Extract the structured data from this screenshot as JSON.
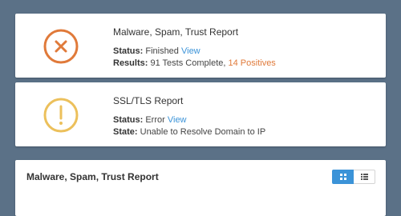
{
  "colors": {
    "background": "#5b7187",
    "error_icon": "#e07a3a",
    "warning_icon": "#ecc05b",
    "link": "#3b93d8",
    "positives": "#e07a3a"
  },
  "cards": [
    {
      "icon": "x-circle-icon",
      "title": "Malware, Spam, Trust Report",
      "line1_label": "Status:",
      "line1_value": "Finished",
      "line1_link": "View",
      "line2_label": "Results:",
      "line2_value": "91 Tests Complete,",
      "line2_highlight": "14 Positives"
    },
    {
      "icon": "exclamation-circle-icon",
      "title": "SSL/TLS Report",
      "line1_label": "Status:",
      "line1_value": "Error",
      "line1_link": "View",
      "line2_label": "State:",
      "line2_value": "Unable to Resolve Domain to IP"
    }
  ],
  "panel": {
    "title": "Malware, Spam, Trust Report",
    "view_toggle": [
      {
        "icon": "grid-view-icon",
        "active": true
      },
      {
        "icon": "list-view-icon",
        "active": false
      }
    ]
  }
}
